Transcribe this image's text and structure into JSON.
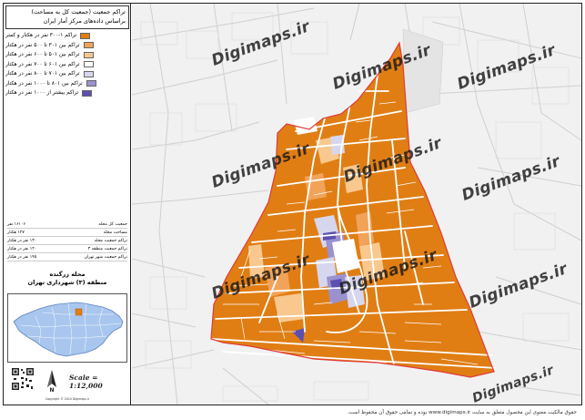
{
  "title": {
    "line1": "تراکم جمعیت (جمعیت کل به مساحت)",
    "line2": "براساس داده‌های مرکز آمار ایران"
  },
  "legend": [
    {
      "label": "تراکم ۱-۳۰۰ نفر در هکتار و کمتر",
      "color": "#e07e14"
    },
    {
      "label": "تراکم بین ۳۰۱ تا ۵۰۰ نفر در هکتار",
      "color": "#f2a35a"
    },
    {
      "label": "تراکم بین ۵۰۱ تا ۶۰۰ نفر در هکتار",
      "color": "#f8c88e"
    },
    {
      "label": "تراکم بین ۶۰۱ تا ۷۰۰ نفر در هکتار",
      "color": "#ffffff"
    },
    {
      "label": "تراکم بین ۷۰۱ تا ۸۰۰ نفر در هکتار",
      "color": "#d6d6ee"
    },
    {
      "label": "تراکم بین ۸۰۱ تا ۱۰۰۰ نفر در هکتار",
      "color": "#9a91cf"
    },
    {
      "label": "تراکم بیشتر از ۱۰۰۰ نفر در هکتار",
      "color": "#5c4fb0"
    }
  ],
  "stats": [
    {
      "label": "جمعیت کل محله",
      "value": "۱۶۱۰۶ نفر"
    },
    {
      "label": "مساحت محله",
      "value": "۱۲۷ هکتار"
    },
    {
      "label": "تراکم جمعیت محله",
      "value": "۱۳۰ نفر در هکتار"
    },
    {
      "label": "تراکم جمعیت منطقه ۳",
      "value": "۱۲۰ نفر در هکتار"
    },
    {
      "label": "تراکم جمعیت شهر تهران",
      "value": "۱۴۵ نفر در هکتار"
    }
  ],
  "area": {
    "line1": "محله زرگنده",
    "line2": "منطقه (۳) شهرداری تهران"
  },
  "scale": "Scale = 1:12,000",
  "north_label": "N",
  "watermark_text": "Digimaps.ir",
  "panel_footer": "Copyright © 2024 Digimaps.ir",
  "footer": "حقوق مالکیت معنوی این محصول متعلق به سایت www.digimaps.ir بوده و تمامی حقوق آن محفوظ است.",
  "colors": {
    "orange": "#e07e14",
    "light_orange": "#f2a35a",
    "peach": "#f8c88e",
    "lavender": "#d6d6ee",
    "purple": "#9a91cf",
    "dark_purple": "#5c4fb0",
    "boundary": "#e03a3a",
    "map_bg": "#f1f1f1",
    "inset_fill": "#a8c6ee"
  }
}
